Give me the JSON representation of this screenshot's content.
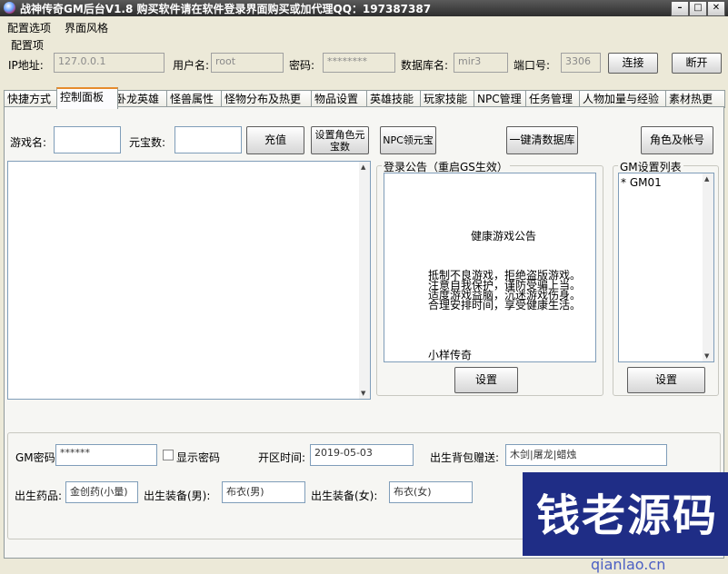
{
  "window": {
    "title": "战神传奇GM后台V1.8   购买软件请在软件登录界面购买或加代理QQ：197387387",
    "min_label": "–",
    "max_label": "□",
    "close_label": "✕"
  },
  "menu": [
    "配置选项",
    "界面风格"
  ],
  "config": {
    "section_label": "配置项",
    "ip_label": "IP地址:",
    "ip_value": "127.0.0.1",
    "user_label": "用户名:",
    "user_value": "root",
    "pwd_label": "密码:",
    "pwd_value": "********",
    "db_label": "数据库名:",
    "db_value": "mir3",
    "port_label": "端口号:",
    "port_value": "3306",
    "connect": "连接",
    "disconnect": "断开"
  },
  "tabs": [
    "快捷方式",
    "控制面板",
    "卧龙英雄",
    "怪兽属性",
    "怪物分布及热更",
    "物品设置",
    "英雄技能",
    "玩家技能",
    "NPC管理",
    "任务管理",
    "人物加量与经验",
    "素材热更"
  ],
  "active_tab": "控制面板",
  "control": {
    "game_name_label": "游戏名:",
    "game_name_value": "",
    "yuanbao_label": "元宝数:",
    "yuanbao_value": "",
    "recharge": "充值",
    "set_role_yuanbao": "设置角色元宝数",
    "npc_yuanbao": "NPC领元宝",
    "clear_db": "一键清数据库",
    "role_account": "角色及帐号"
  },
  "announce": {
    "legend": "登录公告（重启GS生效）",
    "title": "健康游戏公告",
    "lines": [
      "抵制不良游戏，拒绝盗版游戏。",
      "注意自我保护，谨防受骗上当。",
      "适度游戏益脑，沉迷游戏伤身。",
      "合理安排时间，享受健康生活。"
    ],
    "footer": "小样传奇",
    "set": "设置"
  },
  "gmlist": {
    "legend": "GM设置列表",
    "content": "* GM01",
    "set": "设置"
  },
  "bottom": {
    "gm_pwd_label": "GM密码:",
    "gm_pwd_value": "******",
    "show_pwd": "显示密码",
    "open_time_label": "开区时间:",
    "open_time_value": "2019-05-03",
    "bag_gift_label": "出生背包赠送:",
    "bag_gift_value": "木剑|屠龙|蜡烛",
    "potion_label": "出生药品:",
    "potion_value": "金创药(小量)",
    "equip_male_label": "出生装备(男):",
    "equip_male_value": "布衣(男)",
    "equip_female_label": "出生装备(女):",
    "equip_female_value": "布衣(女)"
  },
  "watermark": {
    "text": "钱老源码",
    "url": "qianlao.cn"
  }
}
